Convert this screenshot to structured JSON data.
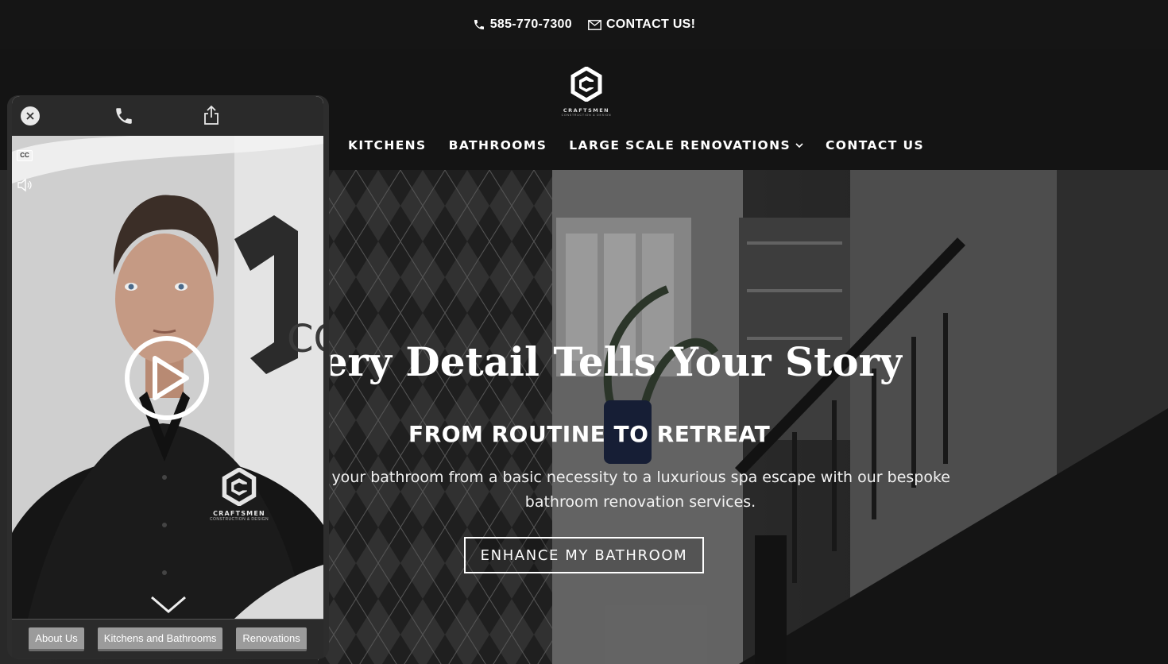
{
  "topbar": {
    "phone": "585-770-7300",
    "contact": "CONTACT US!",
    "icons": [
      "phone-icon",
      "envelope-icon"
    ]
  },
  "header": {
    "logo_name": "CRAFTSMEN",
    "logo_sub": "CONSTRUCTION & DESIGN",
    "nav": [
      {
        "label": "KITCHENS"
      },
      {
        "label": "BATHROOMS"
      },
      {
        "label": "LARGE SCALE RENOVATIONS",
        "has_dropdown": true
      },
      {
        "label": "CONTACT US"
      }
    ]
  },
  "hero": {
    "title": "Where Every Detail Tells Your Story",
    "subtitle": "FROM ROUTINE TO RETREAT",
    "text_line1": "Transform your bathroom from a basic necessity to a luxurious spa escape with our bespoke",
    "text_line2": "bathroom renovation services.",
    "button": "ENHANCE MY BATHROOM"
  },
  "video_widget": {
    "cc_label": "CC",
    "shirt_logo_name": "CRAFTSMEN",
    "shirt_logo_sub": "CONSTRUCTION & DESIGN",
    "wall_text": "CO",
    "chips": [
      "About Us",
      "Kitchens and Bathrooms",
      "Renovations"
    ],
    "icons": [
      "close-icon",
      "phone-icon",
      "share-icon",
      "cc-icon",
      "volume-icon",
      "chevron-up-icon",
      "chevron-down-icon",
      "play-icon"
    ]
  },
  "colors": {
    "background": "#141414",
    "accent": "#ffffff",
    "chip": "#9b9b9b"
  }
}
